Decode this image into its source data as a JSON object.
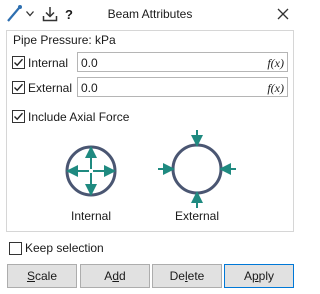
{
  "window": {
    "title": "Beam Attributes",
    "help_label": "?"
  },
  "group": {
    "title": "Pipe Pressure: kPa"
  },
  "internal": {
    "label": "Internal",
    "checked": true,
    "value": "0.0",
    "fx": "f(x)"
  },
  "external": {
    "label": "External",
    "checked": true,
    "value": "0.0",
    "fx": "f(x)"
  },
  "axial": {
    "label": "Include Axial Force",
    "checked": true
  },
  "diagrams": {
    "internal_label": "Internal",
    "external_label": "External",
    "ring_color": "#4a5672",
    "arrow_color": "#1f8a80"
  },
  "keep_selection": {
    "label": "Keep selection",
    "checked": false
  },
  "buttons": {
    "scale": {
      "first": "S",
      "rest": "cale"
    },
    "add": {
      "first": "A",
      "mid": "d",
      "rest": "d"
    },
    "delete": {
      "first": "De",
      "mid": "l",
      "rest": "ete"
    },
    "apply": {
      "first": "A",
      "mid": "p",
      "rest": "ply"
    }
  }
}
